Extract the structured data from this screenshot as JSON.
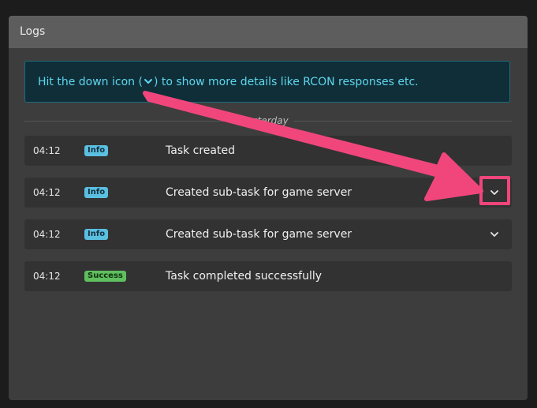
{
  "panel": {
    "title": "Logs"
  },
  "notice": {
    "text_before": "Hit the down icon (",
    "text_after": ") to show more details like RCON responses etc.",
    "icon": "chevron-down-icon"
  },
  "divider": {
    "label": "Yesterday"
  },
  "logs": [
    {
      "time": "04:12",
      "level": "Info",
      "message": "Task created",
      "expandable": false
    },
    {
      "time": "04:12",
      "level": "Info",
      "message": "Created sub-task for game server",
      "expandable": true
    },
    {
      "time": "04:12",
      "level": "Info",
      "message": "Created sub-task for game server",
      "expandable": true
    },
    {
      "time": "04:12",
      "level": "Success",
      "message": "Task completed successfully",
      "expandable": false
    }
  ],
  "colors": {
    "annotation_arrow": "#f0467c",
    "info_badge": "#5bbfe0",
    "success_badge": "#5fbf5f",
    "notice_text": "#5fd6ee"
  }
}
